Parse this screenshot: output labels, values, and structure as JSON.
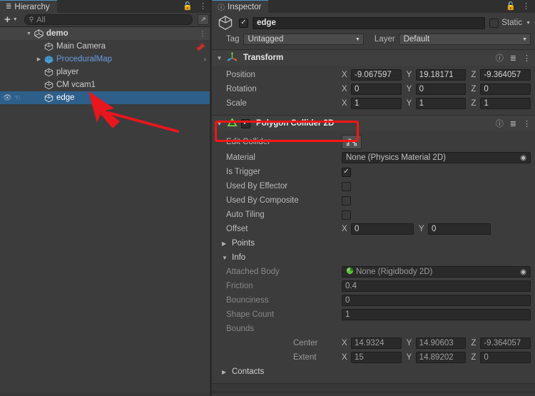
{
  "hierarchy": {
    "tab_label": "Hierarchy",
    "tab_icon": "hierarchy-icon",
    "lock_icon": "lock-icon",
    "menu_icon": "kebab-menu-icon",
    "toolbar": {
      "add_label": "+",
      "add_dropdown_icon": "chevron-down-icon",
      "search_icon": "search-icon",
      "search_value": "",
      "search_placeholder": "All",
      "window_icon": "open-window-icon"
    },
    "rows": [
      {
        "label": "demo",
        "type": "scene",
        "icon": "unity-scene-icon",
        "indent": 0,
        "expander": "▼",
        "selected": false,
        "kebab": true
      },
      {
        "label": "Main Camera",
        "type": "gameobject",
        "icon": "gameobject-cube-icon",
        "indent": 1,
        "expander": "",
        "selected": false,
        "badge": "camera-preview-icon"
      },
      {
        "label": "ProceduralMap",
        "type": "prefab",
        "icon": "prefab-cube-icon",
        "indent": 1,
        "expander": "▶",
        "selected": false,
        "chevron": "›"
      },
      {
        "label": "player",
        "type": "gameobject",
        "icon": "gameobject-cube-icon",
        "indent": 1,
        "expander": "",
        "selected": false
      },
      {
        "label": "CM vcam1",
        "type": "gameobject",
        "icon": "gameobject-cube-icon",
        "indent": 1,
        "expander": "",
        "selected": false
      },
      {
        "label": "edge",
        "type": "gameobject",
        "icon": "gameobject-cube-icon",
        "indent": 1,
        "expander": "",
        "selected": true,
        "visibility_icon": "eye-icon",
        "pickability_icon": "hand-icon"
      }
    ]
  },
  "inspector": {
    "tab_label": "Inspector",
    "tab_icon": "info-icon",
    "lock_icon": "lock-icon",
    "menu_icon": "kebab-menu-icon",
    "object_header": {
      "icon": "gameobject-cube-icon",
      "enabled_checkbox": true,
      "name": "edge",
      "static_checked": false,
      "static_label": "Static",
      "static_dropdown_icon": "chevron-down-icon",
      "tag_label": "Tag",
      "tag_value": "Untagged",
      "layer_label": "Layer",
      "layer_value": "Default"
    },
    "transform": {
      "title": "Transform",
      "icon": "transform-axis-icon",
      "expanded": true,
      "help_icon": "help-icon",
      "preset_icon": "preset-icon",
      "menu_icon": "kebab-menu-icon",
      "rows": [
        {
          "label": "Position",
          "x": "-9.067597",
          "y": "19.18171",
          "z": "-9.364057"
        },
        {
          "label": "Rotation",
          "x": "0",
          "y": "0",
          "z": "0"
        },
        {
          "label": "Scale",
          "x": "1",
          "y": "1",
          "z": "1"
        }
      ],
      "axis_labels": [
        "X",
        "Y",
        "Z"
      ]
    },
    "polygon_collider": {
      "title": "Polygon Collider 2D",
      "icon": "polygon-collider-2d-icon",
      "enabled_checkbox": true,
      "expanded": true,
      "help_icon": "help-icon",
      "preset_icon": "preset-icon",
      "menu_icon": "kebab-menu-icon",
      "highlight_color": "#fb1414",
      "edit_collider": {
        "label": "Edit Collider",
        "button_icon": "edit-collider-icon"
      },
      "material": {
        "label": "Material",
        "value": "None (Physics Material 2D)",
        "picker_icon": "object-picker-icon"
      },
      "toggles": [
        {
          "label": "Is Trigger",
          "checked": true
        },
        {
          "label": "Used By Effector",
          "checked": false
        },
        {
          "label": "Used By Composite",
          "checked": false
        },
        {
          "label": "Auto Tiling",
          "checked": false
        }
      ],
      "offset": {
        "label": "Offset",
        "x_axis": "X",
        "x": "0",
        "y_axis": "Y",
        "y": "0"
      },
      "points": {
        "label": "Points",
        "expanded": false,
        "arrow": "▶"
      },
      "info": {
        "label": "Info",
        "expanded": true,
        "arrow": "▼",
        "attached_body": {
          "label": "Attached Body",
          "value": "None (Rigidbody 2D)",
          "icon": "rigidbody-2d-icon",
          "picker_icon": "object-picker-icon"
        },
        "friction": {
          "label": "Friction",
          "value": "0.4"
        },
        "bounciness": {
          "label": "Bounciness",
          "value": "0"
        },
        "shape_count": {
          "label": "Shape Count",
          "value": "1"
        },
        "bounds": {
          "label": "Bounds",
          "center": {
            "label": "Center",
            "x": "14.9324",
            "y": "14.90603",
            "z": "-9.364057"
          },
          "extent": {
            "label": "Extent",
            "x": "15",
            "y": "14.89202",
            "z": "0"
          },
          "axis_labels": [
            "X",
            "Y",
            "Z"
          ]
        }
      },
      "contacts": {
        "label": "Contacts",
        "expanded": false,
        "arrow": "▶"
      }
    }
  },
  "annotations": {
    "arrow_color": "#e8161d",
    "arrow_name": "red-pointer-arrow",
    "box_name": "red-highlight-box"
  }
}
